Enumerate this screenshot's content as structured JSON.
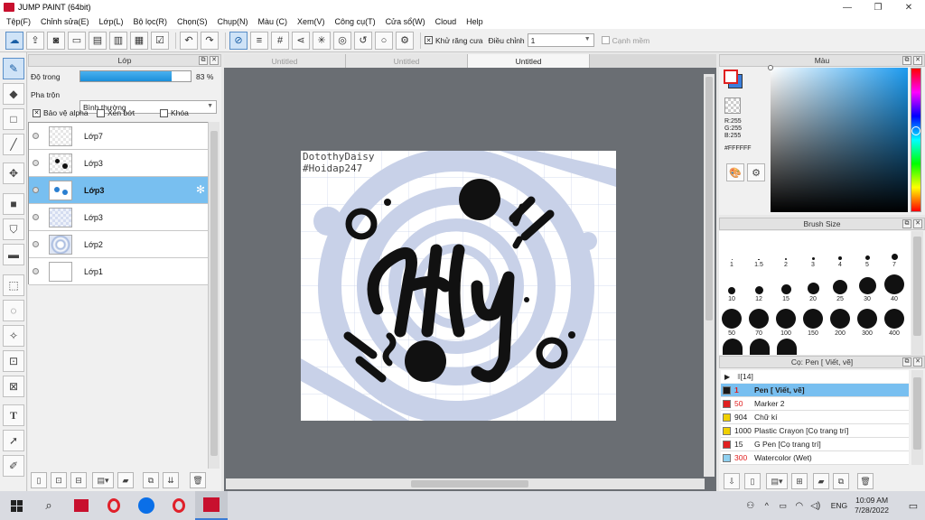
{
  "window": {
    "title": "JUMP PAINT (64bit)",
    "minimize": "—",
    "maximize": "❐",
    "close": "✕"
  },
  "menu": [
    "Tệp(F)",
    "Chỉnh sửa(E)",
    "Lớp(L)",
    "Bộ lọc(R)",
    "Chọn(S)",
    "Chụp(N)",
    "Màu (C)",
    "Xem(V)",
    "Công cụ(T)",
    "Cửa sổ(W)",
    "Cloud",
    "Help"
  ],
  "toolbar": {
    "antialias_label": "Khử răng cưa",
    "antialias_checked": true,
    "adjust_label": "Điều chỉnh",
    "adjust_value": "1",
    "snap_label": "Cạnh mềm",
    "snap_checked": false
  },
  "layer_panel": {
    "title": "Lớp",
    "opacity_label": "Độ trong",
    "opacity_value": "83 %",
    "opacity_fraction": 0.83,
    "blend_label": "Pha trộn",
    "blend_value": "Bình thường",
    "protect_alpha": "Bảo vệ alpha",
    "clipping": "Xén bớt",
    "lock": "Khóa",
    "layers": [
      {
        "name": "Lớp7",
        "selected": false
      },
      {
        "name": "Lớp3",
        "selected": false
      },
      {
        "name": "Lớp3",
        "selected": true
      },
      {
        "name": "Lớp3",
        "selected": false
      },
      {
        "name": "Lớp2",
        "selected": false
      },
      {
        "name": "Lớp1",
        "selected": false
      }
    ]
  },
  "tabs": [
    "Untitled",
    "Untitled",
    "Untitled"
  ],
  "canvas": {
    "watermark_line1": "DotothyDaisy",
    "watermark_line2": "#Hoidap247",
    "lettering": "Hy"
  },
  "color_panel": {
    "title": "Màu",
    "r": "R:255",
    "g": "G:255",
    "b": "B:255",
    "hex": "#FFFFFF"
  },
  "brush_panel": {
    "title": "Brush Size",
    "sizes": [
      "1",
      "1.5",
      "2",
      "3",
      "4",
      "5",
      "7",
      "10",
      "12",
      "15",
      "20",
      "25",
      "30",
      "40",
      "50",
      "70",
      "100",
      "150",
      "200",
      "300",
      "400"
    ]
  },
  "pen_panel": {
    "title": "Cọ: Pen [ Viết, vẽ]",
    "group_label": "[14]",
    "pens": [
      {
        "count": "1",
        "name": "Pen [ Viết, vẽ]",
        "color": "#1a1a1a",
        "selected": true
      },
      {
        "count": "50",
        "name": "Marker 2",
        "color": "#e02020",
        "selected": false
      },
      {
        "count": "904",
        "name": "Chữ kí",
        "color": "#f0d000",
        "selected": false
      },
      {
        "count": "1000",
        "name": "Plastic Crayon [Cọ trang trí]",
        "color": "#f0d000",
        "selected": false
      },
      {
        "count": "15",
        "name": "G Pen [Cọ trang trí]",
        "color": "#e02020",
        "selected": false
      },
      {
        "count": "300",
        "name": "Watercolor (Wet)",
        "color": "#8fd0f0",
        "selected": false
      }
    ]
  },
  "taskbar": {
    "time": "10:09 AM",
    "date": "7/28/2022",
    "lang": "ENG"
  }
}
